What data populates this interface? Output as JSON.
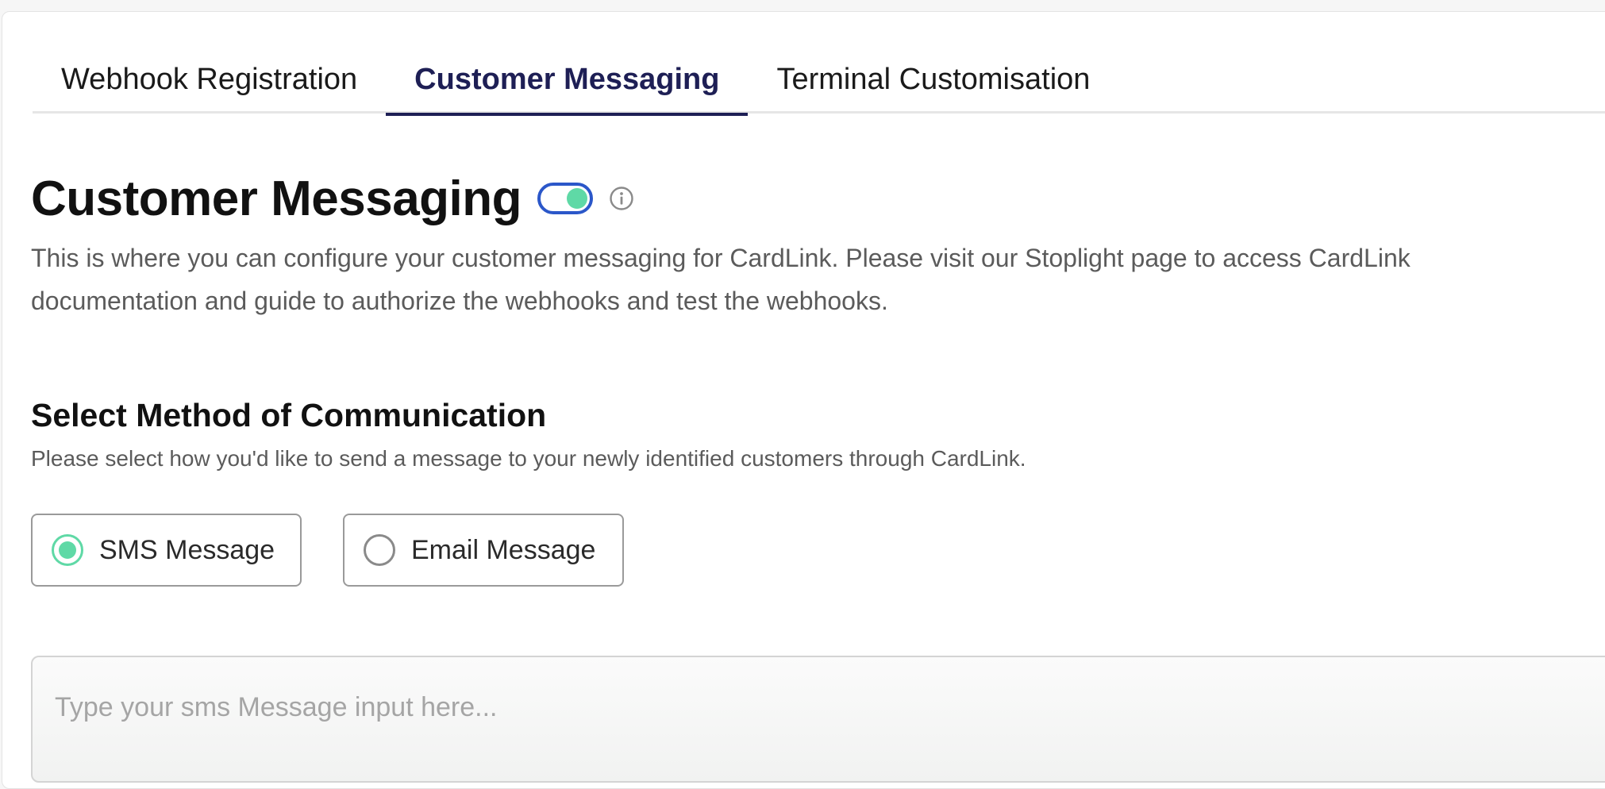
{
  "tabs": [
    {
      "label": "Webhook Registration",
      "active": false
    },
    {
      "label": "Customer Messaging",
      "active": true
    },
    {
      "label": "Terminal Customisation",
      "active": false
    }
  ],
  "page": {
    "title": "Customer Messaging",
    "enabled": true,
    "description": "This is where you can configure your customer messaging for CardLink. Please visit our Stoplight page to access CardLink documentation and guide to authorize the webhooks and test the webhooks."
  },
  "communication": {
    "title": "Select Method of Communication",
    "description": "Please select how you'd like to send a message to your newly identified customers through CardLink.",
    "options": [
      {
        "label": "SMS Message",
        "selected": true
      },
      {
        "label": "Email Message",
        "selected": false
      }
    ]
  },
  "message_input": {
    "value": "",
    "placeholder": "Type your sms Message input here..."
  },
  "icons": {
    "info": "info-circle-icon"
  },
  "colors": {
    "active_tab": "#1e1f55",
    "toggle_border": "#2b57c9",
    "accent_green": "#5fd9a6"
  }
}
